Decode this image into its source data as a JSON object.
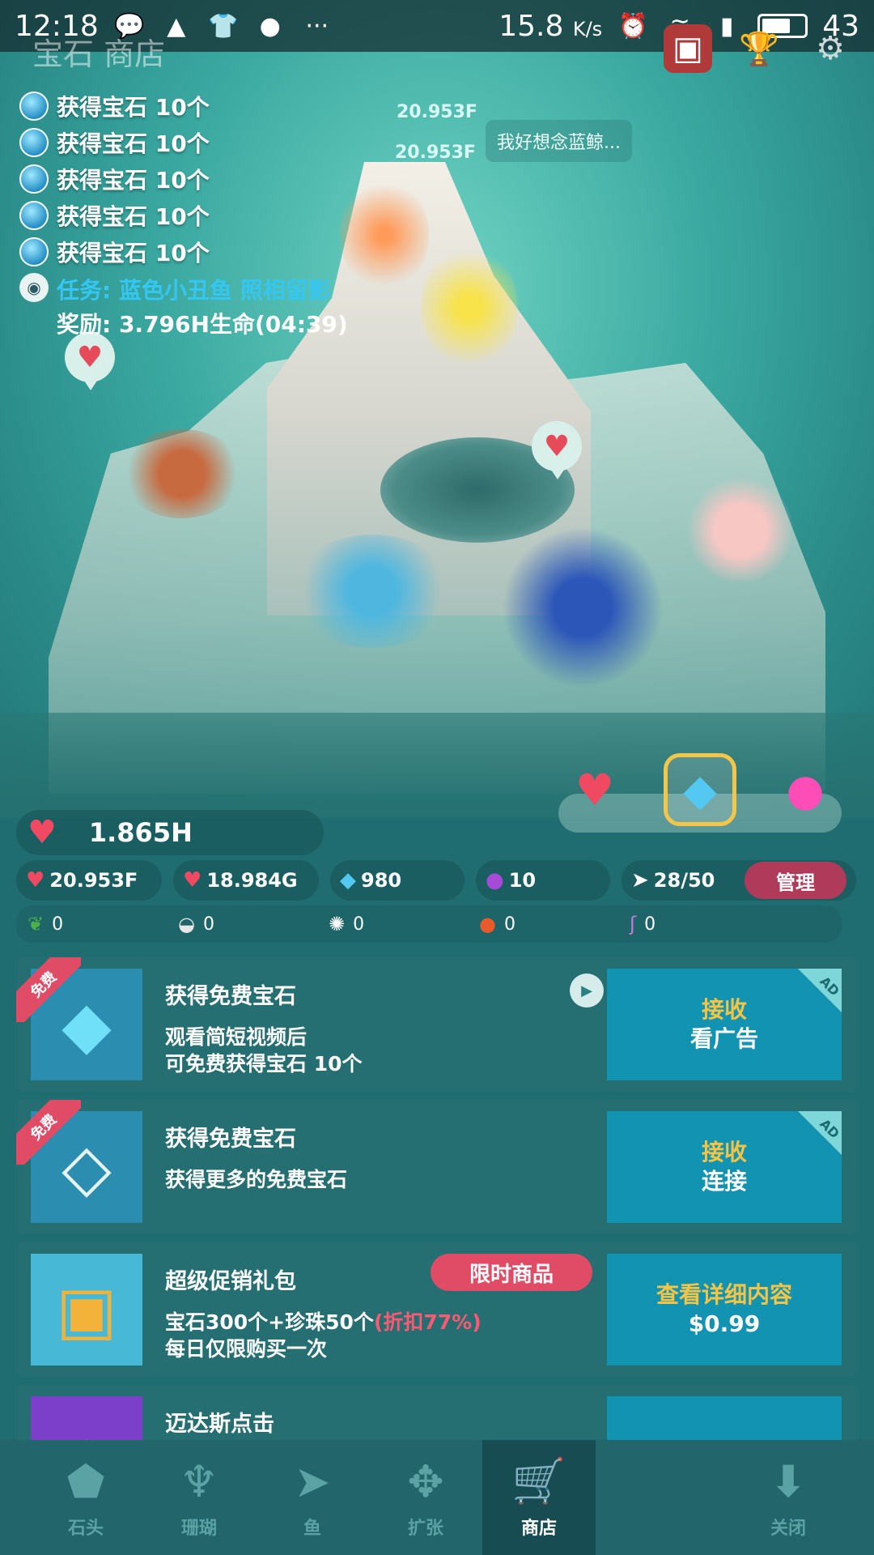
{
  "status_bar": {
    "time": "12:18",
    "icons_left": [
      "chat-icon",
      "notification-icon",
      "shirt-icon",
      "avatar-icon",
      "more-icon"
    ],
    "speed": "15.8",
    "speed_unit": "K/s",
    "battery": "43"
  },
  "header": {
    "title": "宝石 商店"
  },
  "scene": {
    "float_values": [
      "20.953F",
      "20.953F"
    ],
    "speech": "我好想念蓝鲸..."
  },
  "log": {
    "items": [
      "获得宝石 10个",
      "获得宝石 10个",
      "获得宝石 10个",
      "获得宝石 10个",
      "获得宝石 10个"
    ],
    "mission_title": "任务: 蓝色小丑鱼 照相留影",
    "mission_reward": "奖励: 3.796H生命(04:39)"
  },
  "stats": {
    "life": "1.865H",
    "row2": [
      {
        "icon": "heart-tap-icon",
        "value": "20.953F"
      },
      {
        "icon": "heart-timer-icon",
        "value": "18.984G"
      },
      {
        "icon": "gem-icon",
        "value": "980"
      },
      {
        "icon": "pearl-icon",
        "value": "10"
      },
      {
        "icon": "fish-icon",
        "value": "28/50"
      }
    ],
    "manage_label": "管理",
    "row3": [
      {
        "icon": "seaweed-icon",
        "value": "0"
      },
      {
        "icon": "shell-icon",
        "value": "0"
      },
      {
        "icon": "urchin-icon",
        "value": "0"
      },
      {
        "icon": "crab-icon",
        "value": "0"
      },
      {
        "icon": "seahorse-icon",
        "value": "0"
      }
    ]
  },
  "shop": {
    "items": [
      {
        "ribbon": "免费",
        "title": "获得免费宝石",
        "desc1": "观看简短视频后",
        "desc2": "可免费获得宝石 10个",
        "btn1": "接收",
        "btn2": "看广告",
        "corner": "AD"
      },
      {
        "ribbon": "免费",
        "title": "获得免费宝石",
        "desc1": "获得更多的免费宝石",
        "btn1": "接收",
        "btn2": "连接",
        "corner": "AD"
      },
      {
        "title": "超级促销礼包",
        "badge": "限时商品",
        "desc1_a": "宝石300个+珍珠50个",
        "desc1_b": "(折扣77%)",
        "desc2": "每日仅限购买一次",
        "btn1": "查看详细内容",
        "btn2": "$0.99"
      },
      {
        "title": "迈达斯点击"
      }
    ]
  },
  "nav": {
    "items": [
      {
        "label": "石头",
        "icon": "stone-icon"
      },
      {
        "label": "珊瑚",
        "icon": "coral-icon"
      },
      {
        "label": "鱼",
        "icon": "fish-icon"
      },
      {
        "label": "扩张",
        "icon": "expand-icon"
      },
      {
        "label": "商店",
        "icon": "cart-icon"
      },
      {
        "label": "关闭",
        "icon": "close-down-icon"
      }
    ],
    "active": "商店"
  },
  "colors": {
    "accent_red": "#e04c66",
    "button_blue": "#1293b2",
    "gold_text": "#f6c445",
    "panel": "#256e72"
  }
}
